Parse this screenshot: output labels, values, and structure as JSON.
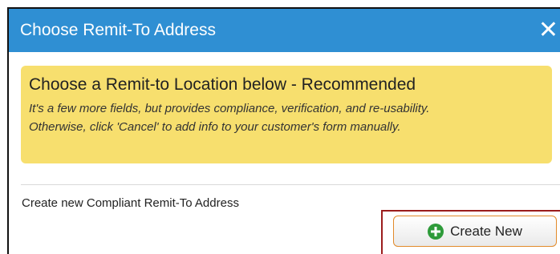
{
  "dialog": {
    "title": "Choose Remit-To Address",
    "close_glyph": "✕"
  },
  "banner": {
    "heading": "Choose a Remit-to Location below - Recommended",
    "line1": "It's a few more fields, but provides compliance, verification, and re-usability.",
    "line2": "Otherwise, click 'Cancel' to add info to your customer's form manually."
  },
  "create_section": {
    "label": "Create new Compliant Remit-To Address",
    "button_label": "Create New",
    "button_icon": "plus-circle-icon"
  },
  "colors": {
    "title_bar": "#2f8fd3",
    "banner_bg": "#f7df6e",
    "highlight_border": "#9b1c1c",
    "button_border": "#e28a2a",
    "plus_icon": "#2e9b3a"
  }
}
